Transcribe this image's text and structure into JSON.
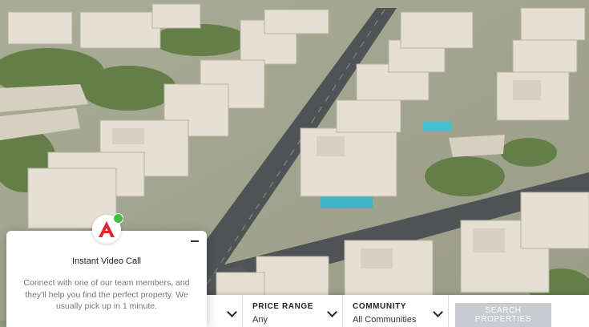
{
  "chat": {
    "title": "Instant Video Call",
    "body": "Connect with one of our team members, and they'll help you find the perfect property. We usually pick up in 1 minute.",
    "minimize_icon": "minus-icon",
    "avatar_icon": "brand-a-logo-icon",
    "online_color": "#3cc43c"
  },
  "search": {
    "fields": [
      {
        "label": "",
        "value": ""
      },
      {
        "label": "PRICE RANGE",
        "value": "Any"
      },
      {
        "label": "COMMUNITY",
        "value": "All Communities"
      }
    ],
    "button_label": "SEARCH PROPERTIES",
    "button_color": "#c8ccd0"
  },
  "colors": {
    "brand_red": "#e0262b",
    "road": "#4f5356",
    "villa": "#e6e0d4",
    "greenery": "#5f7a42"
  }
}
